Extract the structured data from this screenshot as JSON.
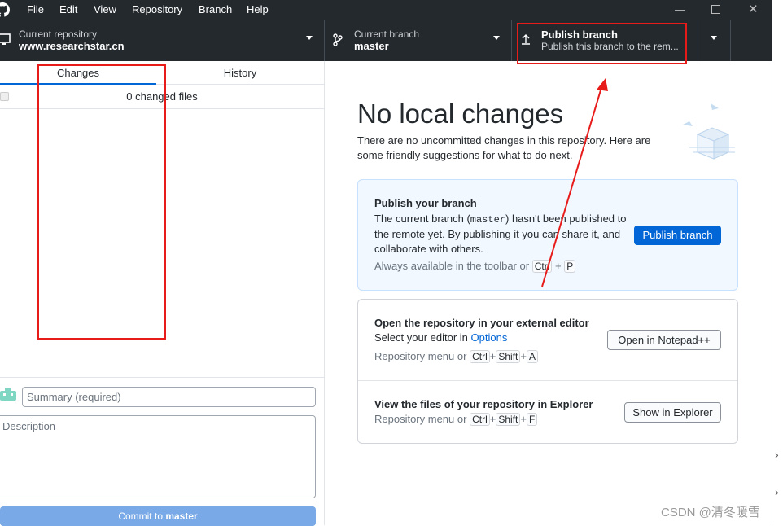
{
  "menubar": {
    "items": [
      "File",
      "Edit",
      "View",
      "Repository",
      "Branch",
      "Help"
    ]
  },
  "toolbar": {
    "repo_label": "Current repository",
    "repo_value": "www.researchstar.cn",
    "branch_label": "Current branch",
    "branch_value": "master",
    "publish_label": "Publish branch",
    "publish_desc": "Publish this branch to the rem..."
  },
  "sidebar": {
    "tabs": [
      "Changes",
      "History"
    ],
    "changed_files": "0 changed files",
    "summary_placeholder": "Summary (required)",
    "description_placeholder": "Description",
    "commit_prefix": "Commit to ",
    "commit_branch": "master"
  },
  "main": {
    "heading": "No local changes",
    "subtitle": "There are no uncommitted changes in this repository. Here are some friendly suggestions for what to do next.",
    "publish_card": {
      "title": "Publish your branch",
      "text_1": "The current branch (",
      "branch_code": "master",
      "text_2": ") hasn't been published to the remote yet. By publishing it you can share it, and collaborate with others.",
      "hint": "Always available in the toolbar or",
      "keys": [
        "Ctrl",
        "P"
      ],
      "button": "Publish branch"
    },
    "editor_card": {
      "title": "Open the repository in your external editor",
      "text": "Select your editor in",
      "link": "Options",
      "hint": "Repository menu or",
      "keys": [
        "Ctrl",
        "Shift",
        "A"
      ],
      "button": "Open in Notepad++"
    },
    "explorer_card": {
      "title": "View the files of your repository in Explorer",
      "hint": "Repository menu or",
      "keys": [
        "Ctrl",
        "Shift",
        "F"
      ],
      "button": "Show in Explorer"
    }
  },
  "watermark": "CSDN @清冬暖雪",
  "colors": {
    "toolbar_bg": "#24292e",
    "accent": "#0366d6",
    "annotation": "#e81b1b"
  }
}
